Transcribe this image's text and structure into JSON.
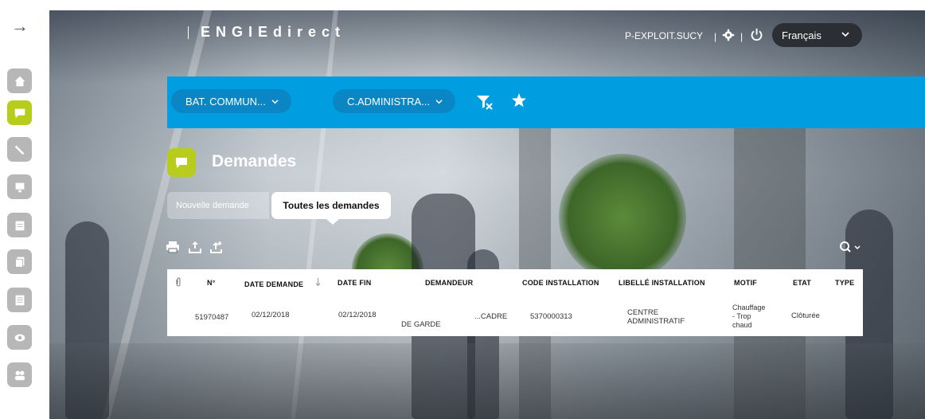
{
  "app": {
    "brand": "ENGIEdirect",
    "user": "P-EXPLOIT.SUCY",
    "separator": "|",
    "language": "Français"
  },
  "rail": {
    "collapse_icon": "arrow-right-icon",
    "items": [
      {
        "icon": "home-icon",
        "active": false
      },
      {
        "icon": "chat-icon",
        "active": true
      },
      {
        "icon": "wrench-icon",
        "active": false
      },
      {
        "icon": "monitor-icon",
        "active": false
      },
      {
        "icon": "calendar-icon",
        "active": false
      },
      {
        "icon": "documents-icon",
        "active": false
      },
      {
        "icon": "report-icon",
        "active": false
      },
      {
        "icon": "eye-icon",
        "active": false
      },
      {
        "icon": "users-icon",
        "active": false
      }
    ]
  },
  "filters": {
    "building": "BAT. COMMUN...",
    "installation": "C.ADMINISTRA...",
    "clear_filter_icon": "filter-clear-icon",
    "favorite_icon": "star-icon"
  },
  "page": {
    "title": "Demandes",
    "tabs": {
      "new": "Nouvelle demande",
      "all": "Toutes les demandes"
    }
  },
  "toolbar": {
    "icons": [
      "print-icon",
      "export-icon",
      "export-all-icon"
    ],
    "search_icon": "search-icon"
  },
  "table": {
    "columns": [
      "N°",
      "DATE DEMANDE",
      "DATE FIN",
      "DEMANDEUR",
      "CODE INSTALLATION",
      "LIBELLÉ INSTALLATION",
      "MOTIF",
      "ETAT",
      "TYPE"
    ],
    "rows": [
      {
        "numero": "51970487",
        "date_demande": "02/12/2018",
        "date_fin": "02/12/2018",
        "demandeur_1": "DE GARDE",
        "demandeur_2": "...CADRE",
        "code_installation": "5370000313",
        "libelle_line1": "CENTRE",
        "libelle_line2": "ADMINISTRATIF",
        "motif_line1": "Chauffage",
        "motif_line2": "- Trop",
        "motif_line3": "chaud",
        "etat": "Clôturée",
        "type": ""
      }
    ]
  },
  "colors": {
    "accent_green": "#b7cc1c",
    "bar_blue": "#009de0",
    "filter_blue": "#0a86c4",
    "rail_grey": "#b7b7b7",
    "lang_dark": "#2b2f33"
  }
}
